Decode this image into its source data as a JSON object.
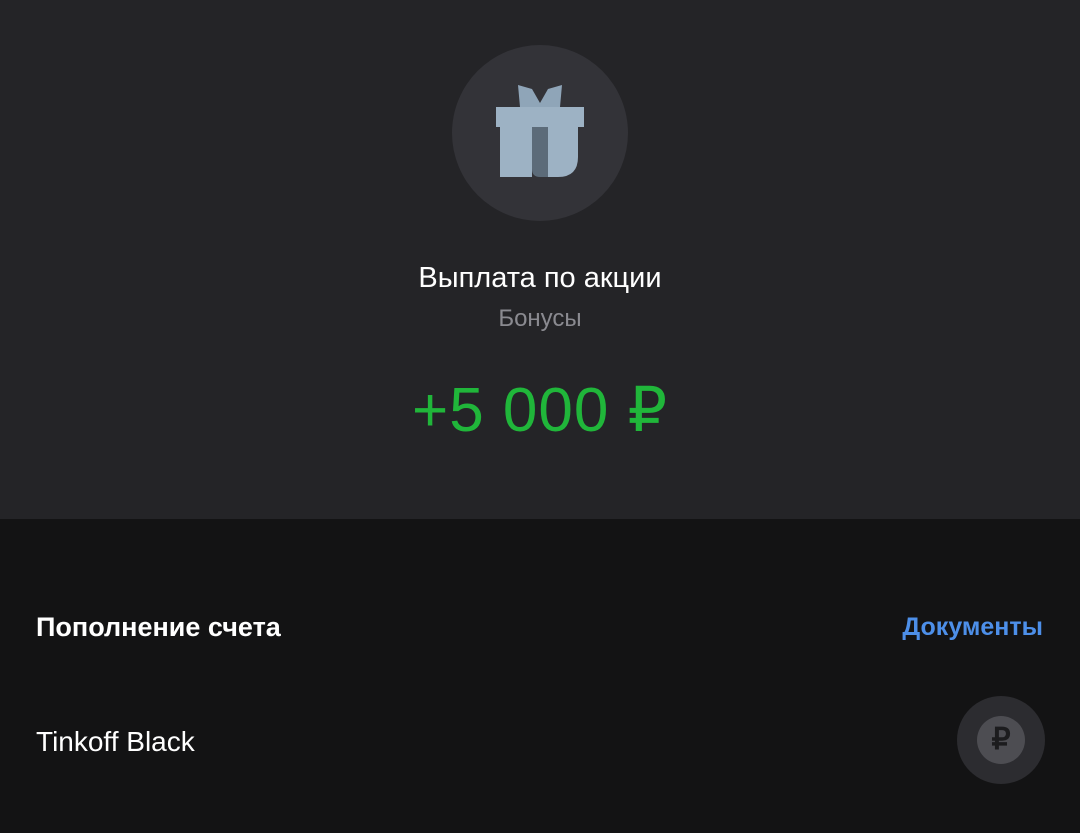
{
  "operation": {
    "title": "Выплата по акции",
    "category": "Бонусы",
    "amount": "+5 000 ₽",
    "amount_color": "#20b63a",
    "icon": "gift-icon"
  },
  "details": {
    "section_title": "Пополнение счета",
    "documents_link": "Документы",
    "account_name": "Tinkoff Black",
    "account_icon": "ruble-icon",
    "account_icon_glyph": "₽"
  },
  "colors": {
    "top_background": "#242427",
    "bottom_background": "#131314",
    "link": "#4d8fe9"
  }
}
